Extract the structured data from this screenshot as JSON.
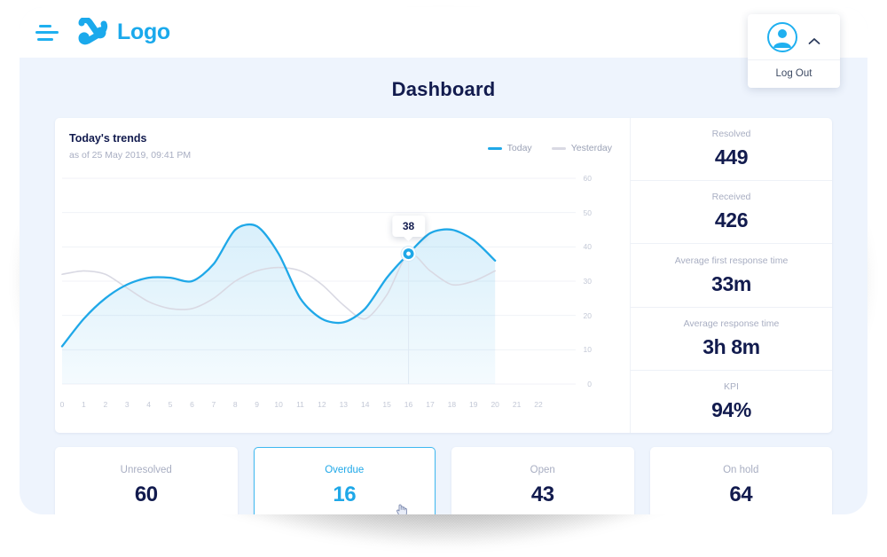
{
  "brand": {
    "name": "Logo",
    "accent": "#1aa9ec",
    "menu_icon": "hamburger-icon"
  },
  "user_menu": {
    "avatar_icon": "user-avatar-icon",
    "chevron_icon": "chevron-up-icon",
    "logout_label": "Log Out"
  },
  "page": {
    "title": "Dashboard"
  },
  "chart_card": {
    "title": "Today's trends",
    "subtitle": "as of 25 May 2019, 09:41 PM",
    "legend": [
      {
        "label": "Today",
        "color": "#1fa8e8"
      },
      {
        "label": "Yesterday",
        "color": "#d9d9e3"
      }
    ],
    "tooltip_value": "38"
  },
  "kpis": [
    {
      "label": "Resolved",
      "value": "449"
    },
    {
      "label": "Received",
      "value": "426"
    },
    {
      "label": "Average first response time",
      "value": "33m"
    },
    {
      "label": "Average response time",
      "value": "3h 8m"
    },
    {
      "label": "KPI",
      "value": "94%"
    }
  ],
  "stats": [
    {
      "label": "Unresolved",
      "value": "60",
      "selected": false
    },
    {
      "label": "Overdue",
      "value": "16",
      "selected": true
    },
    {
      "label": "Open",
      "value": "43",
      "selected": false
    },
    {
      "label": "On hold",
      "value": "64",
      "selected": false
    }
  ],
  "chart_data": {
    "type": "line",
    "title": "Today's trends",
    "subtitle": "as of 25 May 2019, 09:41 PM",
    "xlabel": "",
    "ylabel": "",
    "xlim": [
      0,
      22
    ],
    "ylim": [
      0,
      60
    ],
    "grid": true,
    "legend_position": "top-right",
    "yticks": [
      60,
      50,
      40,
      30,
      20,
      10,
      0
    ],
    "xticks": [
      0,
      1,
      2,
      3,
      4,
      5,
      6,
      7,
      8,
      9,
      10,
      11,
      12,
      13,
      14,
      15,
      16,
      17,
      18,
      19,
      20,
      21,
      22
    ],
    "annotation": {
      "x": 16,
      "y": 38,
      "label": "38",
      "series": "Today"
    },
    "series": [
      {
        "name": "Today",
        "color": "#1fa8e8",
        "filled": true,
        "x": [
          0,
          1,
          2,
          3,
          4,
          5,
          6,
          7,
          8,
          9,
          10,
          11,
          12,
          13,
          14,
          15,
          16,
          17,
          18,
          19,
          20
        ],
        "values": [
          11,
          19,
          25,
          29,
          31,
          31,
          30,
          35,
          45,
          46,
          38,
          25,
          19,
          18,
          22,
          31,
          38,
          44,
          45,
          42,
          36
        ]
      },
      {
        "name": "Yesterday",
        "color": "#d9d9e3",
        "filled": false,
        "x": [
          0,
          1,
          2,
          3,
          4,
          5,
          6,
          7,
          8,
          9,
          10,
          11,
          12,
          13,
          14,
          15,
          16,
          17,
          18,
          19,
          20
        ],
        "values": [
          32,
          33,
          32,
          28,
          24,
          22,
          22,
          25,
          30,
          33,
          34,
          33,
          29,
          23,
          19,
          26,
          38,
          33,
          29,
          30,
          33
        ]
      }
    ]
  }
}
